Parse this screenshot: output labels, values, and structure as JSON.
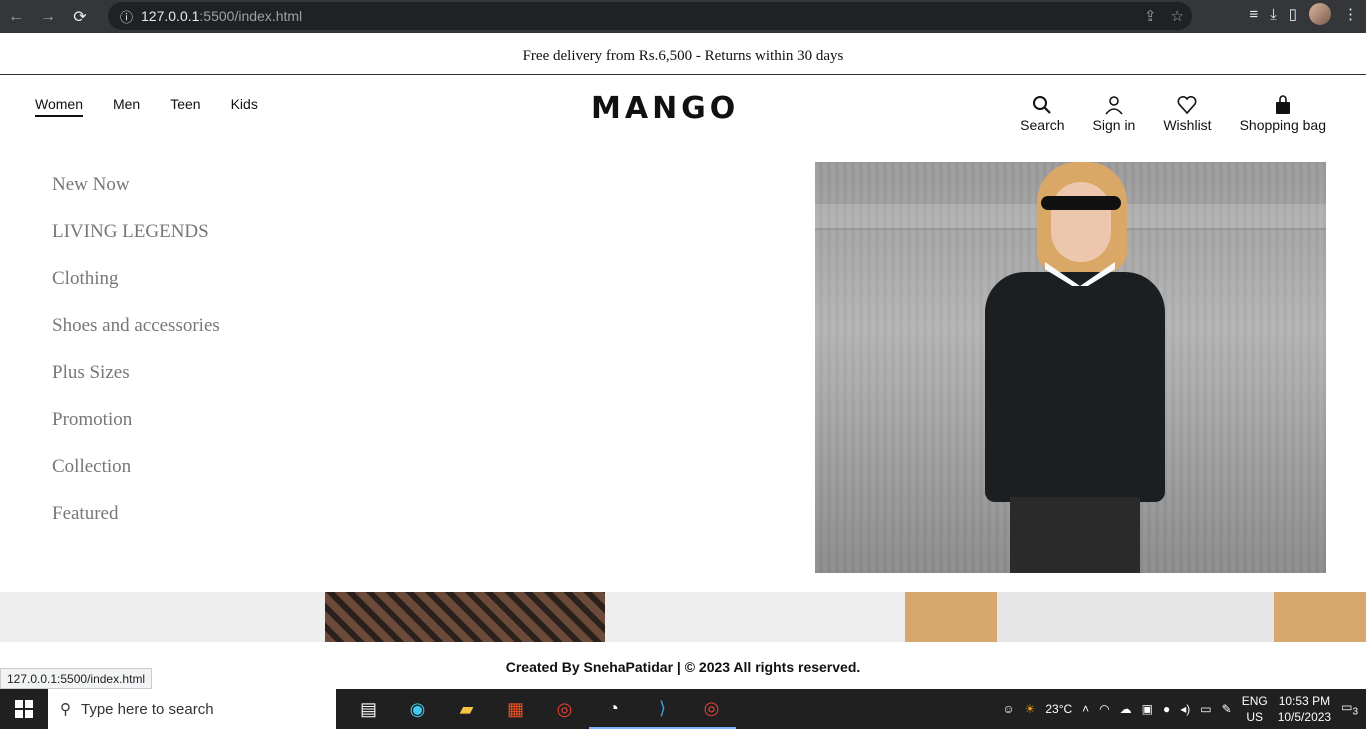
{
  "browser": {
    "url_host": "127.0.0.1",
    "url_rest": ":5500/index.html"
  },
  "announcement": "Free delivery from Rs.6,500 - Returns within 30 days",
  "top_nav": [
    "Women",
    "Men",
    "Teen",
    "Kids"
  ],
  "brand": "MANGO",
  "actions": {
    "search": "Search",
    "signin": "Sign in",
    "wishlist": "Wishlist",
    "bag": "Shopping bag"
  },
  "menu": [
    "New Now",
    "LIVING LEGENDS",
    "Clothing",
    "Shoes and accessories",
    "Plus Sizes",
    "Promotion",
    "Collection",
    "Featured"
  ],
  "footer": "Created By SnehaPatidar | © 2023 All rights reserved.",
  "status_url": "127.0.0.1:5500/index.html",
  "taskbar": {
    "search_placeholder": "Type here to search",
    "weather": "23°C",
    "lang_top": "ENG",
    "lang_bottom": "US",
    "time": "10:53 PM",
    "date": "10/5/2023",
    "notif_count": "3"
  }
}
